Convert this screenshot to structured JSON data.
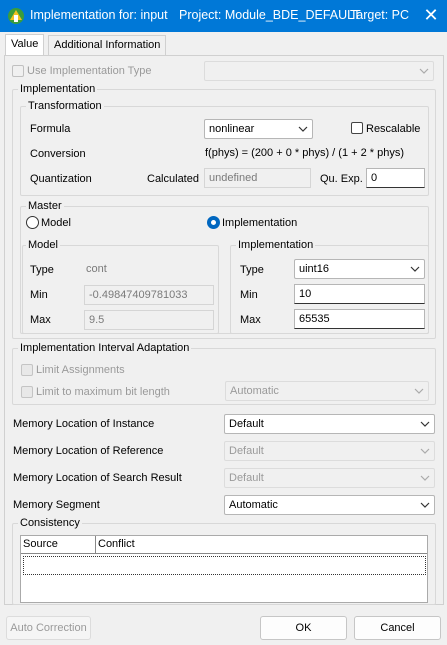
{
  "window": {
    "title": "Implementation for: input",
    "project": "Project: Module_BDE_DEFAULT",
    "target": "Target: PC",
    "close_glyph": "✕"
  },
  "tabs": [
    "Value",
    "Additional Information"
  ],
  "use_implementation_type": {
    "label": "Use Implementation Type",
    "checked": false,
    "combo_value": ""
  },
  "implementation_group": {
    "title": "Implementation",
    "transformation": {
      "title": "Transformation",
      "formula_label": "Formula",
      "formula_value": "nonlinear",
      "rescalable_label": "Rescalable",
      "conversion_label": "Conversion",
      "conversion_value": "f(phys) = (200 + 0 * phys) / (1 + 2 * phys)",
      "quantization_label": "Quantization",
      "calculated_label": "Calculated",
      "calculated_value": "undefined",
      "qu_exp_label": "Qu. Exp.",
      "qu_exp_value": "0"
    },
    "master": {
      "title": "Master",
      "option_model": "Model",
      "option_implementation": "Implementation",
      "selected": "Implementation"
    },
    "model": {
      "title": "Model",
      "type_label": "Type",
      "type_value": "cont",
      "min_label": "Min",
      "min_value": "-0.49847409781033",
      "max_label": "Max",
      "max_value": "9.5"
    },
    "implementation": {
      "title": "Implementation",
      "type_label": "Type",
      "type_value": "uint16",
      "min_label": "Min",
      "min_value": "10",
      "max_label": "Max",
      "max_value": "65535"
    }
  },
  "interval_adaptation": {
    "title": "Implementation Interval Adaptation",
    "limit_assignments_label": "Limit Assignments",
    "limit_bitlength_label": "Limit to maximum bit length",
    "limit_bitlength_value": "Automatic"
  },
  "memory": {
    "instance_label": "Memory Location of Instance",
    "instance_value": "Default",
    "reference_label": "Memory Location of Reference",
    "reference_value": "Default",
    "search_label": "Memory Location of Search Result",
    "search_value": "Default",
    "segment_label": "Memory Segment",
    "segment_value": "Automatic"
  },
  "consistency": {
    "title": "Consistency",
    "columns": [
      "Source",
      "Conflict"
    ],
    "rows": []
  },
  "footer": {
    "auto_correction": "Auto Correction",
    "ok": "OK",
    "cancel": "Cancel"
  },
  "colors": {
    "titlebar": "#0078d7",
    "radio_selected": "#0067c0"
  }
}
